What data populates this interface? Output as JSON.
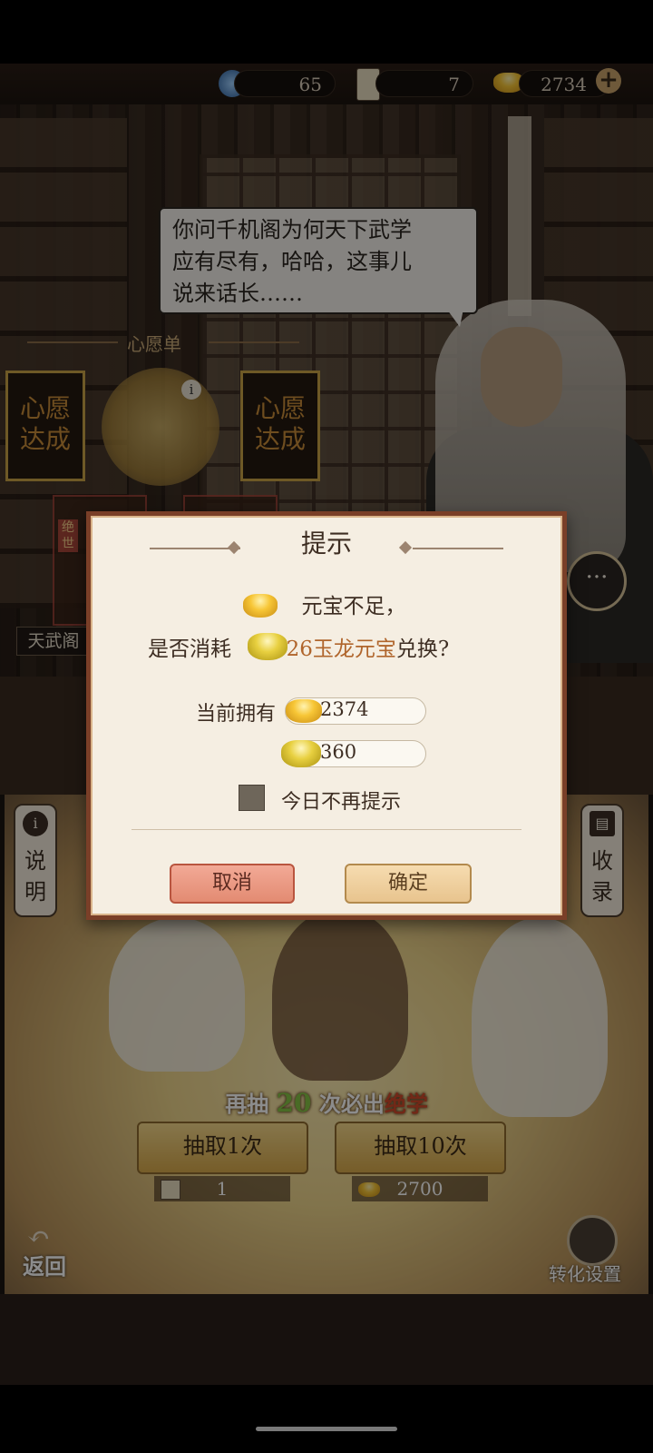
{
  "resources": {
    "orb_count": "65",
    "token_count": "7",
    "ingot_count": "2734"
  },
  "speech": {
    "text": "你问千机阁为何天下武学\n应有尽有，哈哈，这事儿\n说来话长……"
  },
  "wishlist": {
    "title": "心愿单",
    "card_left": "心愿\n达成",
    "card_right": "心愿\n达成",
    "mini_tag": "绝世",
    "location_tag": "天武阁"
  },
  "side": {
    "left_label": "说\n明",
    "right_label": "收\n录"
  },
  "draw": {
    "hint_prefix": "再抽",
    "hint_count": "20",
    "hint_mid": "次必出",
    "hint_suffix": "绝学",
    "btn_one": "抽取1次",
    "btn_ten": "抽取10次",
    "cost_one": "1",
    "cost_ten": "2700"
  },
  "bottom": {
    "back_label": "返回",
    "transform_label": "转化设置"
  },
  "dialog": {
    "title": "提示",
    "msg1": "元宝不足，",
    "msg2_prefix": "是否消耗",
    "msg2_highlight": "326玉龙元宝",
    "msg2_suffix": "兑换?",
    "own_label": "当前拥有",
    "own_gold": "2374",
    "own_jade": "360",
    "checkbox_label": "今日不再提示",
    "cancel_label": "取消",
    "confirm_label": "确定"
  },
  "colors": {
    "accent": "#b0652c",
    "dialog_border": "#7a3f28",
    "hint_green": "#86c345"
  }
}
